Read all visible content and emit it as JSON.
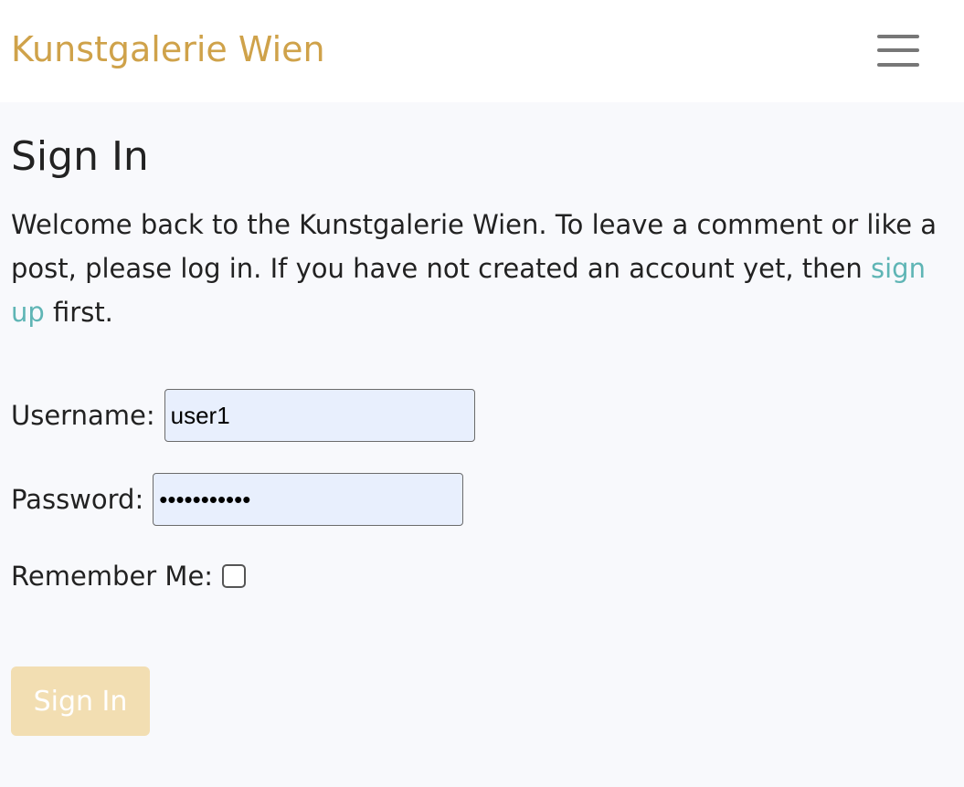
{
  "navbar": {
    "brand": "Kunstgalerie Wien",
    "menu_icon": "hamburger-menu-icon"
  },
  "page": {
    "title": "Sign In",
    "intro_before": "Welcome back to the Kunstgalerie Wien. To leave a comment or like a post, please log in. If you have not created an account yet, then ",
    "signup_link": "sign up",
    "intro_after": " first."
  },
  "form": {
    "username_label": "Username:",
    "username_value": "user1",
    "password_label": "Password:",
    "password_value": "user1passwd",
    "remember_label": "Remember Me:",
    "remember_checked": false,
    "submit_label": "Sign In"
  },
  "colors": {
    "brand": "#cfa24a",
    "link": "#5fb5b5",
    "button_bg": "#f2deb2",
    "input_bg": "#e8effd"
  }
}
